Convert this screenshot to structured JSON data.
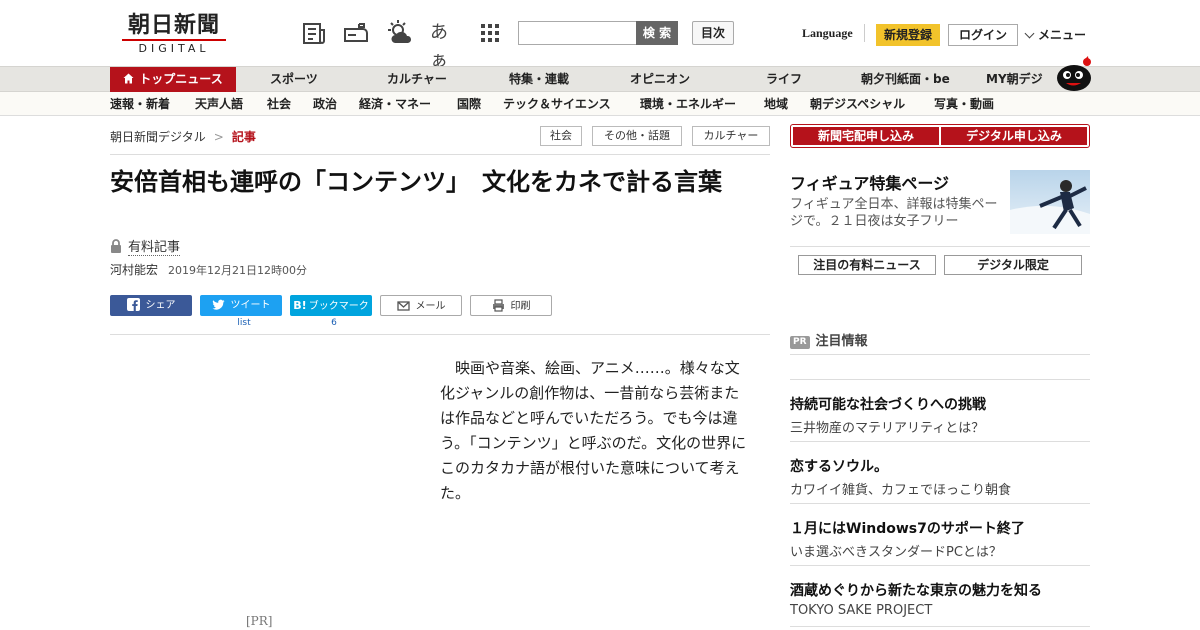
{
  "header": {
    "logo_jp": "朝日新聞",
    "logo_en": "DIGITAL",
    "icon_font_size": "あぁ",
    "search_button": "検 索",
    "toc_button": "目次",
    "language": "Language",
    "signup": "新規登録",
    "login": "ログイン",
    "menu": "メニュー"
  },
  "nav1": {
    "items": [
      "トップニュース",
      "スポーツ",
      "カルチャー",
      "特集・連載",
      "オピニオン",
      "ライフ",
      "朝夕刊紙面・be",
      "MY朝デジ"
    ]
  },
  "nav2": {
    "items": [
      "速報・新着",
      "天声人語",
      "社会",
      "政治",
      "経済・マネー",
      "国際",
      "テック＆サイエンス",
      "環境・エネルギー",
      "地域",
      "朝デジスペシャル",
      "写真・動画"
    ]
  },
  "breadcrumb": {
    "home": "朝日新聞デジタル",
    "sep": ">",
    "current": "記事"
  },
  "tags": [
    "社会",
    "その他・話題",
    "カルチャー"
  ],
  "article": {
    "title": "安倍首相も連呼の「コンテンツ」　文化をカネで計る言葉",
    "paid_label": "有料記事",
    "author": "河村能宏",
    "date": "2019年12月21日12時00分",
    "body": "映画や音楽、絵画、アニメ……。様々な文化ジャンルの創作物は、一昔前なら芸術または作品などと呼んでいただろう。でも今は違う。「コンテンツ」と呼ぶのだ。文化の世界にこのカタカナ語が根付いた意味について考えた。",
    "pr_label": "[PR]"
  },
  "share": {
    "facebook": "シェア",
    "twitter": "ツイート",
    "twitter_count": "list",
    "hatena": "ブックマーク",
    "hatena_count": "6",
    "mail": "メール",
    "print": "印刷"
  },
  "sidebar": {
    "subscribe_paper": "新聞宅配申し込み",
    "subscribe_digital": "デジタル申し込み",
    "feature_title": "フィギュア特集ページ",
    "feature_desc": "フィギュア全日本、詳報は特集ページで。２１日夜は女子フリー",
    "pick_paid": "注目の有料ニュース",
    "pick_digital": "デジタル限定",
    "pr_badge": "PR",
    "pr_heading": "注目情報",
    "ads": [
      {
        "title": "持続可能な社会づくりへの挑戦",
        "sub": "三井物産のマテリアリティとは？"
      },
      {
        "title": "恋するソウル。",
        "sub": "カワイイ雑貨、カフェでほっこり朝食"
      },
      {
        "title": "１月にはWindows7のサポート終了",
        "sub": "いま選ぶべきスタンダードPCとは？"
      },
      {
        "title": "酒蔵めぐりから新たな東京の魅力を知る",
        "sub": "TOKYO SAKE PROJECT"
      }
    ]
  },
  "colors": {
    "brand_red": "#b5121b",
    "signup_yellow": "#f2c32b",
    "facebook": "#3b5998",
    "twitter": "#1da1f2",
    "hatena": "#00a4de"
  }
}
